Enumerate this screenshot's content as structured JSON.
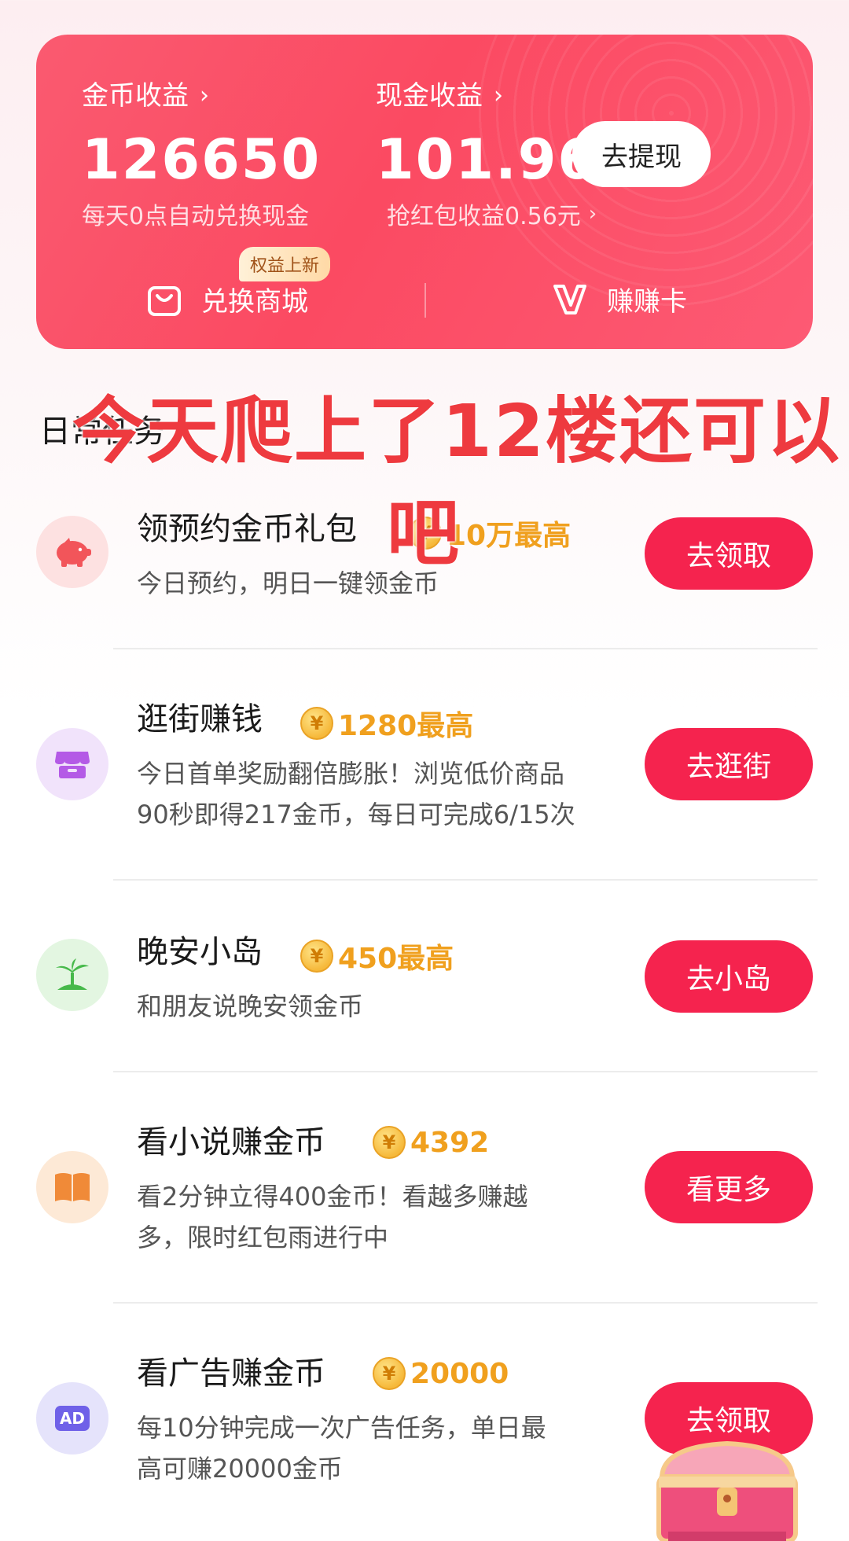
{
  "earnings": {
    "coins_label": "金币收益",
    "coins_value": "126650",
    "coins_note": "每天0点自动兑换现金",
    "cash_label": "现金收益",
    "cash_value": "101.96",
    "cash_note": "抢红包收益0.56元",
    "withdraw_label": "去提现",
    "shop_label": "兑换商城",
    "shop_badge": "权益上新",
    "card_label": "赚赚卡",
    "chevron": "›"
  },
  "section_title": "日常任务",
  "overlay_caption": {
    "line1": "今天爬上了12楼还可以",
    "line2": "吧"
  },
  "tasks": [
    {
      "title": "领预约金币礼包",
      "reward": "10万最高",
      "desc": [
        "今日预约，明日一键领金币"
      ],
      "button": "去领取",
      "icon": "piggy-bank-icon",
      "icon_bg": "#fde1e1",
      "icon_color": "#f2555a"
    },
    {
      "title": "逛街赚钱",
      "reward": "1280最高",
      "desc": [
        "今日首单奖励翻倍膨胀！浏览低价商品",
        "90秒即得217金币，每日可完成6/15次"
      ],
      "button": "去逛街",
      "icon": "store-icon",
      "icon_bg": "#f1e3fb",
      "icon_color": "#b45ae6"
    },
    {
      "title": "晚安小岛",
      "reward": "450最高",
      "desc": [
        "和朋友说晚安领金币"
      ],
      "button": "去小岛",
      "icon": "island-icon",
      "icon_bg": "#e3f6e1",
      "icon_color": "#46b94a"
    },
    {
      "title": "看小说赚金币",
      "reward": "4392",
      "desc": [
        "看2分钟立得400金币！看越多赚越",
        "多，限时红包雨进行中"
      ],
      "button": "看更多",
      "icon": "book-icon",
      "icon_bg": "#fde9d6",
      "icon_color": "#f08a38"
    },
    {
      "title": "看广告赚金币",
      "reward": "20000",
      "desc": [
        "每10分钟完成一次广告任务，单日最",
        "高可赚20000金币"
      ],
      "button": "去领取",
      "icon": "ad-icon",
      "icon_bg": "#e5e3fb",
      "icon_color": "#6f61e8"
    }
  ],
  "coin_symbol": "¥",
  "ad_icon_text": "AD",
  "colors": {
    "accent": "#f5234e",
    "reward": "#f0a01e",
    "overlay": "#ee3a3f"
  }
}
